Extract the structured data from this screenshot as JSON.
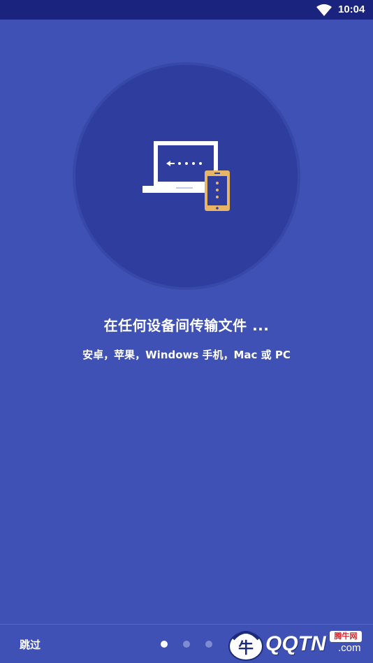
{
  "status_bar": {
    "time": "10:04",
    "wifi_icon": "wifi-icon"
  },
  "onboarding": {
    "illustration_icon": "laptop-phone-transfer-icon",
    "title": "在任何设备间传输文件 ...",
    "subtitle": "安卓，苹果，Windows 手机，Mac 或 PC"
  },
  "footer": {
    "skip_label": "跳过",
    "page_count": 3,
    "active_page": 1
  },
  "watermark": {
    "logo_text": "QQTN",
    "suffix": ".com",
    "badge": "腾牛网"
  },
  "colors": {
    "background": "#3f51b5",
    "status_bar": "#1a237e",
    "circle": "#2f3e9e",
    "device_accent": "#e6b566",
    "text": "#ffffff"
  }
}
